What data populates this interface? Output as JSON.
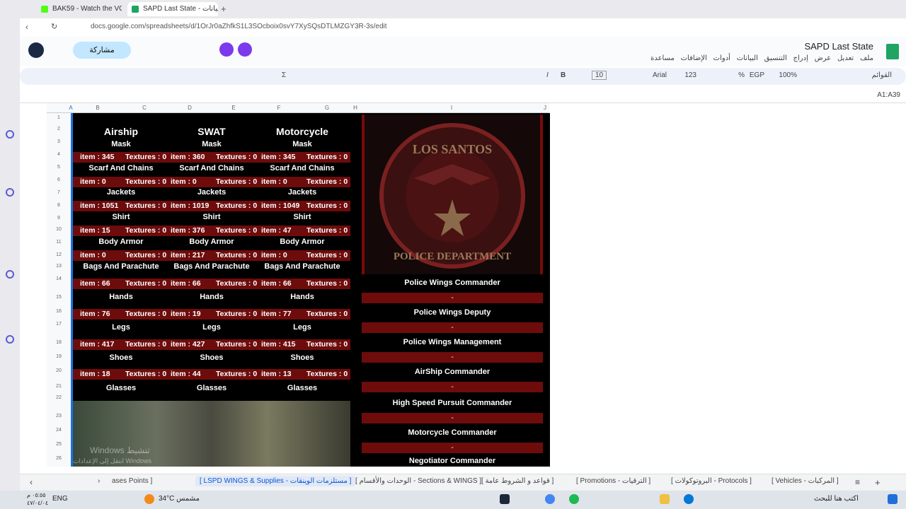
{
  "browser": {
    "tabs": [
      {
        "label": "BAK59 - Watch the VOD",
        "active": false,
        "color": "#53fc18"
      },
      {
        "label": "SAPD Last State - ل بيانات",
        "active": true,
        "color": "#1fa463"
      }
    ],
    "url": "docs.google.com/spreadsheets/d/1OrJr0aZhfkS1L3SOcboix0svY7XySQsDTLMZGY3R-3s/edit"
  },
  "doc": {
    "title": "SAPD Last State",
    "menu": "ملف  تعديل  عرض  إدراج  التنسيق  البيانات  أدوات  الإضافات  مساعدة",
    "share_label": "مشاركة",
    "menus_label": "القوائم",
    "zoom": "100%",
    "currency": "EGP",
    "percent": "%",
    "font": "Arial",
    "font_size": "10",
    "number_format": "123",
    "name_box": "A1:A39"
  },
  "columns": [
    "A",
    "B",
    "C",
    "D",
    "E",
    "F",
    "G",
    "H",
    "I",
    "J"
  ],
  "rows": [
    "1",
    "2",
    "3",
    "4",
    "5",
    "6",
    "7",
    "8",
    "9",
    "10",
    "11",
    "12",
    "13",
    "14",
    "15",
    "16",
    "17",
    "18",
    "19",
    "20",
    "21",
    "22",
    "23",
    "24",
    "25",
    "26"
  ],
  "supplies": {
    "headers": [
      "Airship",
      "SWAT",
      "Motorcycle"
    ],
    "item_prefix": "item : ",
    "textures_label": "Textures : ",
    "categories": [
      {
        "name": "Mask",
        "values": [
          [
            345,
            0
          ],
          [
            360,
            0
          ],
          [
            345,
            0
          ]
        ]
      },
      {
        "name": "Scarf And Chains",
        "values": [
          [
            0,
            0
          ],
          [
            0,
            0
          ],
          [
            0,
            0
          ]
        ]
      },
      {
        "name": "Jackets",
        "values": [
          [
            1051,
            0
          ],
          [
            1019,
            0
          ],
          [
            1049,
            0
          ]
        ]
      },
      {
        "name": "Shirt",
        "values": [
          [
            15,
            0
          ],
          [
            376,
            0
          ],
          [
            47,
            0
          ]
        ]
      },
      {
        "name": "Body Armor",
        "values": [
          [
            0,
            0
          ],
          [
            217,
            0
          ],
          [
            0,
            0
          ]
        ]
      },
      {
        "name": "Bags And Parachute",
        "values": [
          [
            66,
            0
          ],
          [
            66,
            0
          ],
          [
            66,
            0
          ]
        ]
      },
      {
        "name": "Hands",
        "values": [
          [
            76,
            0
          ],
          [
            19,
            0
          ],
          [
            77,
            0
          ]
        ]
      },
      {
        "name": "Legs",
        "values": [
          [
            417,
            0
          ],
          [
            427,
            0
          ],
          [
            415,
            0
          ]
        ]
      },
      {
        "name": "Shoes",
        "values": [
          [
            18,
            0
          ],
          [
            44,
            0
          ],
          [
            13,
            0
          ]
        ]
      },
      {
        "name": "Glasses",
        "values": []
      }
    ]
  },
  "badge": {
    "top": "LOS SANTOS",
    "bottom": "POLICE DEPARTMENT"
  },
  "roles": [
    {
      "title": "Police Wings Commander",
      "value": "-"
    },
    {
      "title": "Police Wings Deputy",
      "value": "-"
    },
    {
      "title": "Police Wings Management",
      "value": "-"
    },
    {
      "title": "AirShip Commander",
      "value": "-"
    },
    {
      "title": "High Speed Pursuit Commander",
      "value": "-"
    },
    {
      "title": "Motorcycle Commander",
      "value": "-"
    },
    {
      "title": "Negotiator Commander",
      "value": ""
    }
  ],
  "watermark": {
    "line1": "Windows تنشيط",
    "line2": "انتقل إلى الإعدادات لتنشيط Windows"
  },
  "sheet_tabs": [
    "ases Points ]",
    "[ LSPD WINGS & Supplies - مستلزمات الوينقات ]",
    "[ الوحدات والأقسام - Sections & WINGS ]",
    "[ قواعد و الشروط عامة ]",
    "[ Promotions - الترقيات ]",
    "[ البروتوكولات - Protocols ]",
    "[ Vehicles - المركبات ]"
  ],
  "taskbar": {
    "time": "٠٥:٥٥ م",
    "date": "٤٧/٠٤/٠٤",
    "lang": "ENG",
    "weather": "34°C  مشمس",
    "search": "اكتب هنا للبحث"
  }
}
